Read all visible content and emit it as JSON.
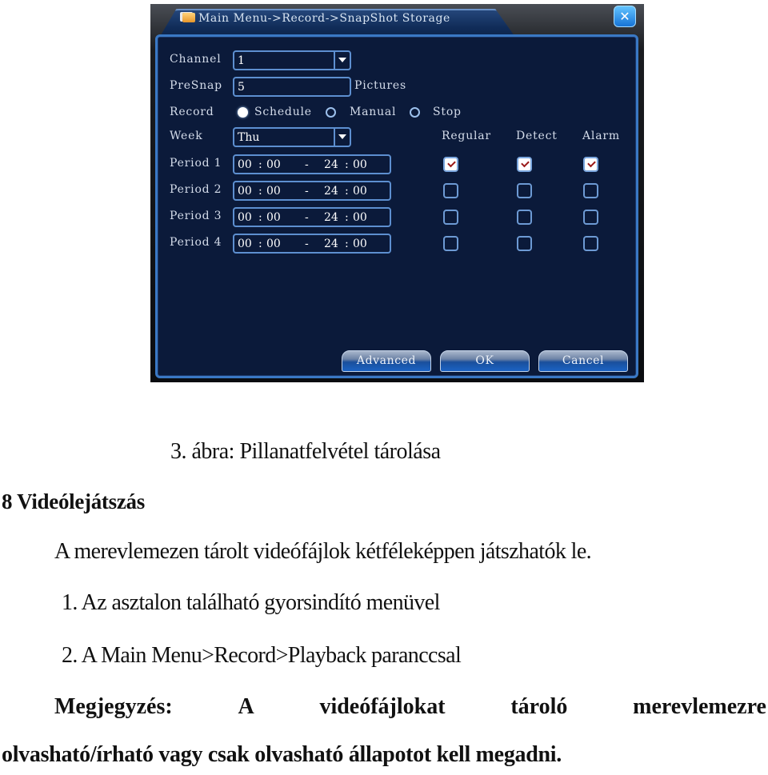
{
  "dvr": {
    "title": "Main Menu->Record->SnapShot Storage",
    "close_label": "✕",
    "channel": {
      "label": "Channel",
      "value": "1"
    },
    "presnap": {
      "label": "PreSnap",
      "value": "5",
      "unit": "Pictures"
    },
    "record": {
      "label": "Record",
      "options": [
        {
          "label": "Schedule",
          "selected": true
        },
        {
          "label": "Manual",
          "selected": false
        },
        {
          "label": "Stop",
          "selected": false
        }
      ]
    },
    "week": {
      "label": "Week",
      "value": "Thu"
    },
    "columns": [
      "Regular",
      "Detect",
      "Alarm"
    ],
    "periods": [
      {
        "label": "Period 1",
        "start_h": "00",
        "start_m": "00",
        "sep": "-",
        "end_h": "24",
        "end_m": "00",
        "regular": true,
        "detect": true,
        "alarm": true
      },
      {
        "label": "Period 2",
        "start_h": "00",
        "start_m": "00",
        "sep": "-",
        "end_h": "24",
        "end_m": "00",
        "regular": false,
        "detect": false,
        "alarm": false
      },
      {
        "label": "Period 3",
        "start_h": "00",
        "start_m": "00",
        "sep": "-",
        "end_h": "24",
        "end_m": "00",
        "regular": false,
        "detect": false,
        "alarm": false
      },
      {
        "label": "Period 4",
        "start_h": "00",
        "start_m": "00",
        "sep": "-",
        "end_h": "24",
        "end_m": "00",
        "regular": false,
        "detect": false,
        "alarm": false
      }
    ],
    "buttons": {
      "advanced": "Advanced",
      "ok": "OK",
      "cancel": "Cancel"
    }
  },
  "document": {
    "caption": "3. ábra: Pillanatfelvétel tárolása",
    "heading": "8 Videólejátszás",
    "paragraph": "A merevlemezen tárolt videófájlok kétféleképpen játszhatók le.",
    "list": [
      "1. Az asztalon található gyorsindító menüvel",
      "2. A Main Menu>Record>Playback paranccsal"
    ],
    "note_words": [
      "Megjegyzés:",
      "A",
      "videófájlokat",
      "tároló",
      "merevlemezre"
    ],
    "note_line2": "olvasható/írható vagy csak olvasható állapotot kell megadni."
  }
}
